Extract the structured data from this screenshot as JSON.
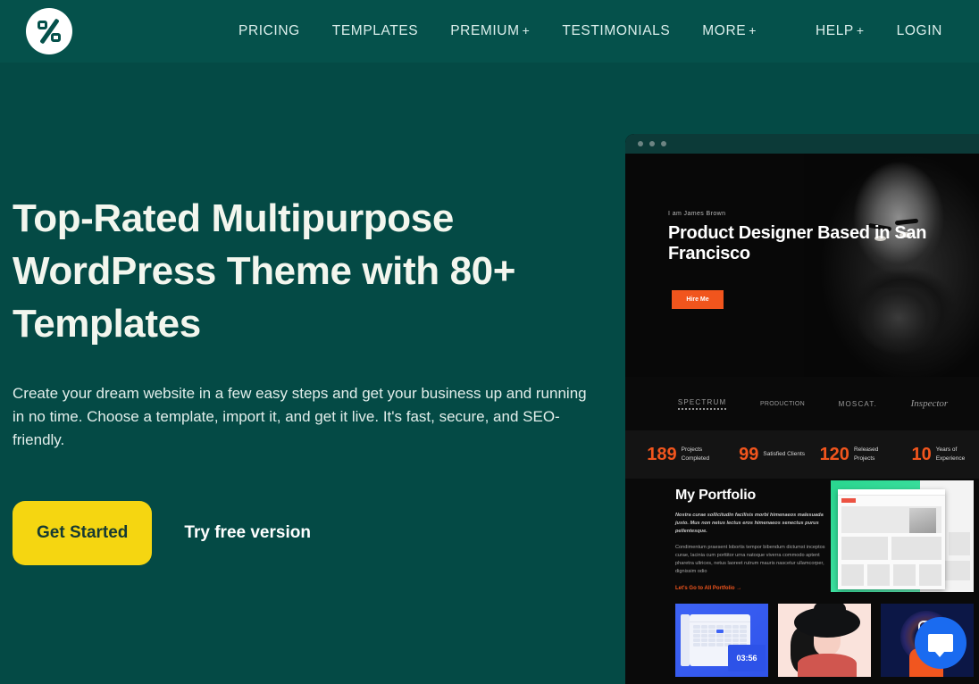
{
  "brand": {
    "logo_icon": "z-percent-logo-icon",
    "accent_teal": "#044a45",
    "accent_yellow": "#f5d611",
    "accent_orange": "#f1551d",
    "chat_blue": "#1a6bf0"
  },
  "nav": {
    "main_items": [
      {
        "label": "PRICING",
        "has_plus": false
      },
      {
        "label": "TEMPLATES",
        "has_plus": false
      },
      {
        "label": "PREMIUM",
        "has_plus": true
      },
      {
        "label": "TESTIMONIALS",
        "has_plus": false
      },
      {
        "label": "MORE",
        "has_plus": true
      }
    ],
    "right_items": [
      {
        "label": "HELP",
        "has_plus": true
      },
      {
        "label": "LOGIN",
        "has_plus": false
      }
    ],
    "plus_glyph": "+"
  },
  "hero": {
    "title": "Top-Rated Multipurpose WordPress Theme with 80+ Templates",
    "subtitle": "Create your dream website in a few easy steps and get your business up and running in no time. Choose a template, import it, and get it live. It's fast, secure, and SEO-friendly.",
    "primary_cta": "Get Started",
    "secondary_cta": "Try free version"
  },
  "mockup": {
    "window_dots": 3,
    "hero": {
      "eyebrow": "I am James Brown",
      "heading": "Product Designer Based in San Francisco",
      "button": "Hire Me"
    },
    "brands": [
      "SPECTRUM",
      "PRODUCTION",
      "MOSCAT.",
      "Inspector"
    ],
    "stats": [
      {
        "number": "189",
        "label": "Projects Completed"
      },
      {
        "number": "99",
        "label": "Satisfied Clients"
      },
      {
        "number": "120",
        "label": "Released Projects"
      },
      {
        "number": "10",
        "label": "Years of Experience"
      }
    ],
    "portfolio": {
      "title": "My Portfolio",
      "lead": "Nostra curae sollicitudin facilisis morbi himenaeos malesuada justo. Mus non netus lectus eros himenaeos senectus purus pellentesque.",
      "body": "Condimentum praesent lobortis tempor bibendum dictumst inceptos curae, lacinia cum porttitor urna natoque viverra commodo aptent pharetra ultrices, netus laoreet rutrum mauris nascetur ullamcorper, dignissim odio",
      "link": "Let's Go to All Portfolio",
      "link_arrow": "→"
    },
    "thumbs": [
      {
        "name": "calendar-timer-thumbnail",
        "timer": "03:56"
      },
      {
        "name": "woman-with-hat-illustration-thumbnail",
        "timer": ""
      },
      {
        "name": "instagram-illustration-thumbnail",
        "timer": ""
      }
    ]
  },
  "chat": {
    "icon": "chat-bubble-icon"
  }
}
